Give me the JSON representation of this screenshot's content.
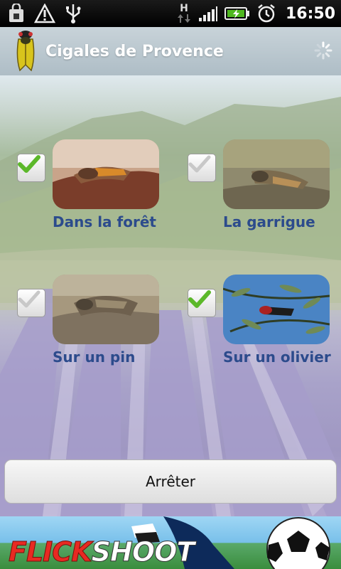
{
  "status_bar": {
    "time": "16:50",
    "network_letter": "H",
    "icons": [
      "shopping-bag-icon",
      "warning-icon",
      "usb-icon",
      "data-arrows-icon",
      "signal-icon",
      "battery-charging-icon",
      "alarm-icon"
    ]
  },
  "app": {
    "title": "Cigales de Provence",
    "logo": "cicada-icon",
    "busy_indicator": "spinner-icon"
  },
  "choices": [
    {
      "label": "Dans la forêt",
      "checked": true
    },
    {
      "label": "La garrigue",
      "checked": false
    },
    {
      "label": "Sur un pin",
      "checked": false
    },
    {
      "label": "Sur un olivier",
      "checked": true
    }
  ],
  "stop_button": {
    "label": "Arrêter"
  },
  "ad": {
    "brand_part1": "FLICK",
    "brand_part2": "SHOOT"
  },
  "colors": {
    "title_bar": "#b8c6ce",
    "label_text": "#2c4b8c",
    "check_green": "#5cb82a",
    "check_gray": "#c8c8c8"
  }
}
